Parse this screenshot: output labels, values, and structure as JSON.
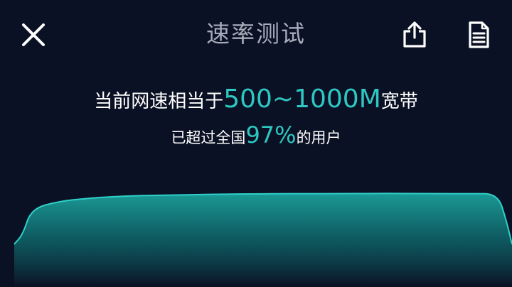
{
  "header": {
    "title": "速率测试",
    "close_icon": "close-icon",
    "share_icon": "share-icon",
    "report_icon": "report-icon"
  },
  "result": {
    "line1_prefix": "当前网速相当于",
    "line1_value": "500~1000M",
    "line1_suffix": "宽带",
    "line2_prefix": "已超过全国",
    "line2_value": "97%",
    "line2_suffix": "的用户"
  },
  "colors": {
    "background": "#0b1124",
    "accent": "#2ec7c1",
    "area_fill": "#1a9a96"
  },
  "speed_curve": {
    "description_type": "area",
    "values": [
      0.45,
      0.55,
      0.82,
      0.9,
      0.93,
      0.95,
      0.96,
      0.965,
      0.97,
      0.975,
      0.978,
      0.98,
      0.98,
      0.98,
      0.982,
      0.983,
      0.982,
      0.98,
      0.98,
      0.98,
      0.7,
      0.45
    ]
  }
}
